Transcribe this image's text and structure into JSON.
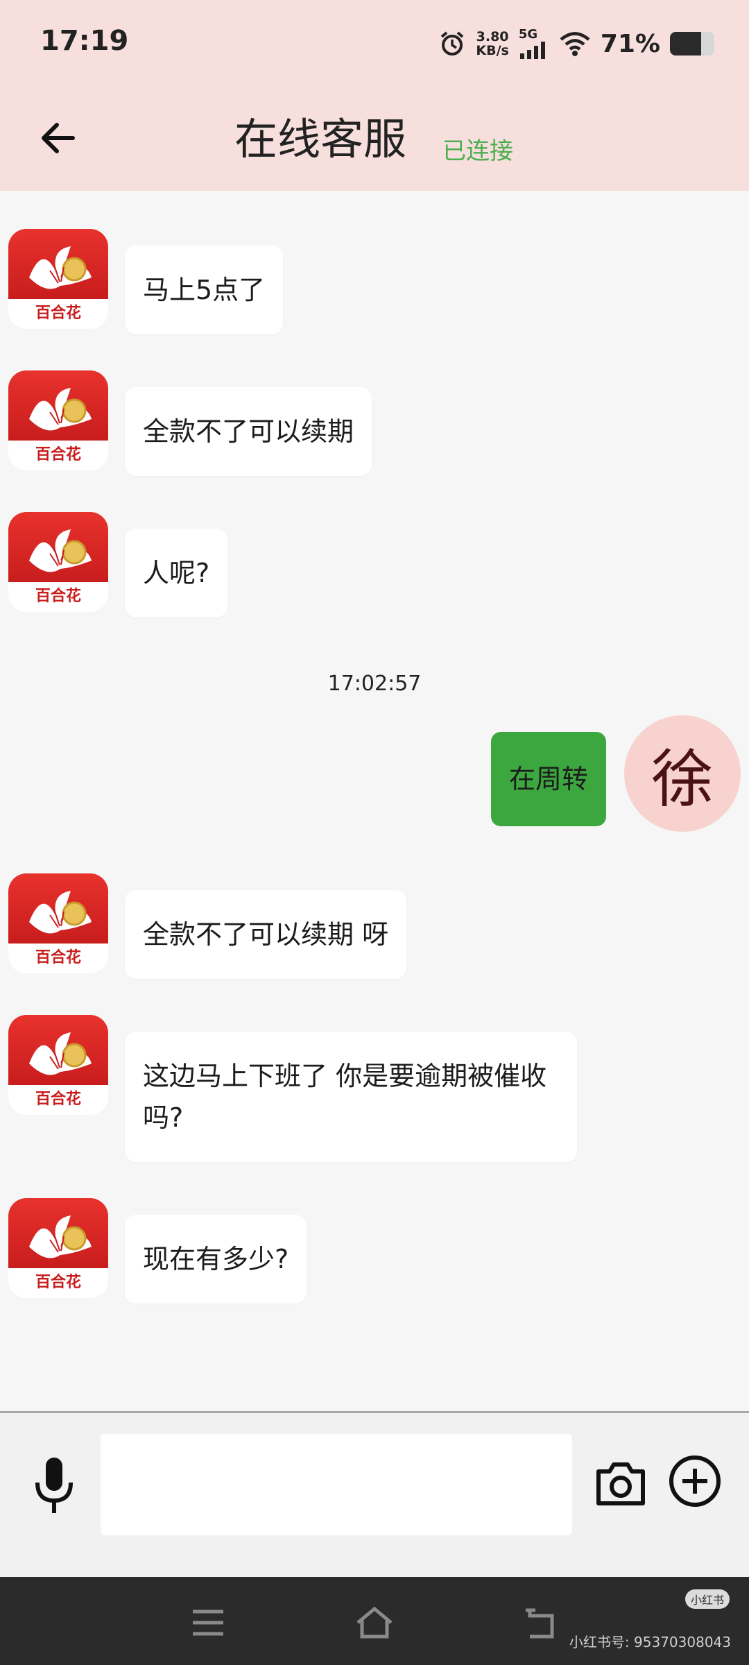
{
  "status_bar": {
    "time": "17:19",
    "net_speed_top": "3.80",
    "net_speed_unit": "KB/s",
    "network": "5G",
    "battery_pct": "71%",
    "battery_level": 0.71
  },
  "header": {
    "title": "在线客服",
    "status": "已连接"
  },
  "agent_avatar": {
    "label": "百合花"
  },
  "messages": [
    {
      "from": "agent",
      "text": "马上5点了"
    },
    {
      "from": "agent",
      "text": "全款不了可以续期"
    },
    {
      "from": "agent",
      "text": "人呢?"
    },
    {
      "type": "timestamp",
      "text": "17:02:57"
    },
    {
      "from": "user",
      "text": "在周转",
      "avatar": "徐"
    },
    {
      "from": "agent",
      "text": "全款不了可以续期 呀"
    },
    {
      "from": "agent",
      "text": "这边马上下班了 你是要逾期被催收吗?"
    },
    {
      "from": "agent",
      "text": "现在有多少?"
    }
  ],
  "input": {
    "placeholder": ""
  },
  "watermark": {
    "logo": "小红书",
    "text": "小红书号: 95370308043"
  },
  "colors": {
    "header_bg": "#f7dfdd",
    "connected": "#4caf50",
    "sent_bubble": "#3da73f",
    "user_avatar_bg": "#f7d2cf"
  }
}
